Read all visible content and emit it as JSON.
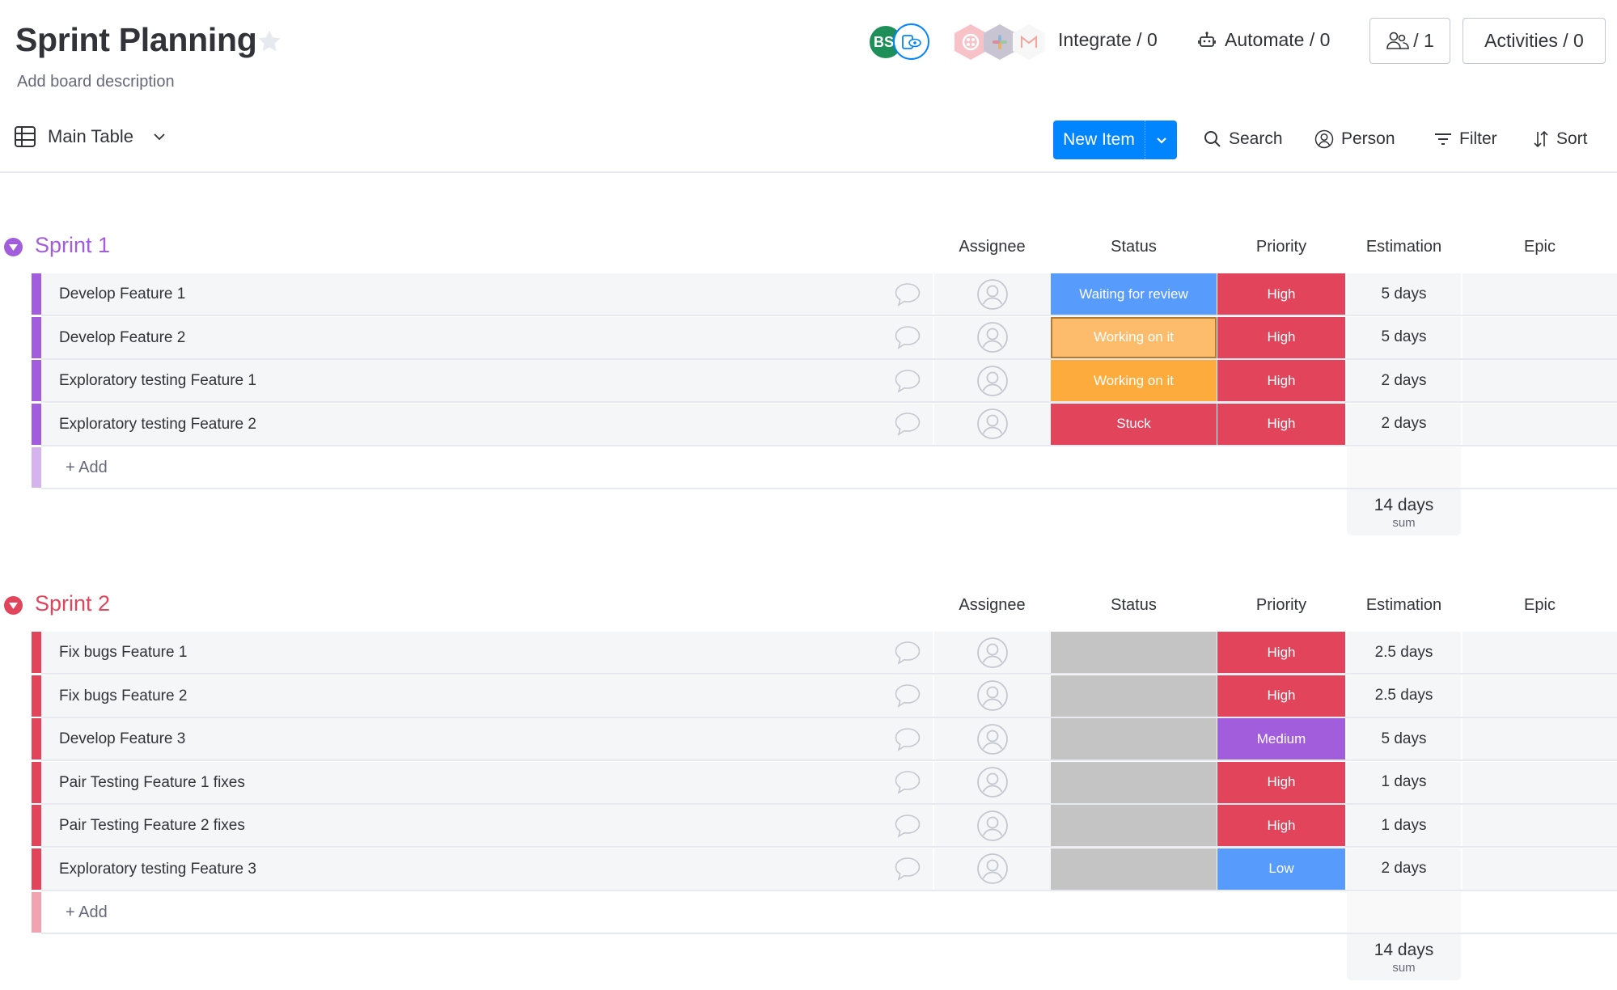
{
  "header": {
    "title": "Sprint Planning",
    "description": "Add board description",
    "avatar_initials": "BS",
    "integrate_label": "Integrate / 0",
    "automate_label": "Automate / 0",
    "members_count": "/ 1",
    "activities_label": "Activities / 0"
  },
  "toolbar": {
    "view_label": "Main Table",
    "new_item_label": "New Item",
    "search_label": "Search",
    "person_label": "Person",
    "filter_label": "Filter",
    "sort_label": "Sort"
  },
  "columns": {
    "assignee": "Assignee",
    "status": "Status",
    "priority": "Priority",
    "estimation": "Estimation",
    "epic": "Epic"
  },
  "colors": {
    "sprint1": "#a25ddc",
    "sprint1_light": "#d5b3ef",
    "sprint2": "#e2445c",
    "sprint2_light": "#f1a4b0",
    "status_waiting": "#579bfc",
    "status_working": "#fdab3d",
    "status_working_hover": "#fdbc6b",
    "status_stuck": "#e2445c",
    "status_empty": "#c4c4c4",
    "priority_high": "#e2445c",
    "priority_medium": "#a25ddc",
    "priority_low": "#579bfc",
    "accent": "#0085ff"
  },
  "groups": [
    {
      "title": "Sprint 1",
      "add_label": "+ Add",
      "sum_value": "14 days",
      "sum_label": "sum",
      "items": [
        {
          "name": "Develop Feature 1",
          "status": "Waiting for review",
          "status_color": "#579bfc",
          "priority": "High",
          "priority_color": "#e2445c",
          "estimation": "5 days"
        },
        {
          "name": "Develop Feature 2",
          "status": "Working on it",
          "status_color": "#fdbc6b",
          "status_selected": true,
          "priority": "High",
          "priority_color": "#e2445c",
          "estimation": "5 days"
        },
        {
          "name": "Exploratory testing Feature 1",
          "status": "Working on it",
          "status_color": "#fdab3d",
          "priority": "High",
          "priority_color": "#e2445c",
          "estimation": "2 days"
        },
        {
          "name": "Exploratory testing Feature 2",
          "status": "Stuck",
          "status_color": "#e2445c",
          "priority": "High",
          "priority_color": "#e2445c",
          "estimation": "2 days"
        }
      ]
    },
    {
      "title": "Sprint 2",
      "add_label": "+ Add",
      "sum_value": "14 days",
      "sum_label": "sum",
      "items": [
        {
          "name": "Fix bugs Feature 1",
          "status": "",
          "status_color": "#c4c4c4",
          "priority": "High",
          "priority_color": "#e2445c",
          "estimation": "2.5 days"
        },
        {
          "name": "Fix bugs Feature 2",
          "status": "",
          "status_color": "#c4c4c4",
          "priority": "High",
          "priority_color": "#e2445c",
          "estimation": "2.5 days"
        },
        {
          "name": "Develop Feature 3",
          "status": "",
          "status_color": "#c4c4c4",
          "priority": "Medium",
          "priority_color": "#a25ddc",
          "estimation": "5 days"
        },
        {
          "name": "Pair Testing Feature 1 fixes",
          "status": "",
          "status_color": "#c4c4c4",
          "priority": "High",
          "priority_color": "#e2445c",
          "estimation": "1 days"
        },
        {
          "name": "Pair Testing Feature 2 fixes",
          "status": "",
          "status_color": "#c4c4c4",
          "priority": "High",
          "priority_color": "#e2445c",
          "estimation": "1 days"
        },
        {
          "name": "Exploratory testing Feature 3",
          "status": "",
          "status_color": "#c4c4c4",
          "priority": "Low",
          "priority_color": "#579bfc",
          "estimation": "2 days"
        }
      ]
    }
  ]
}
